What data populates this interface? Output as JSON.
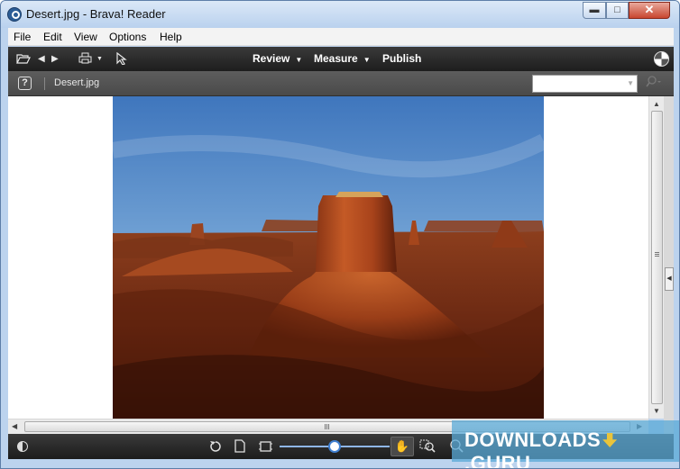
{
  "window": {
    "title": "Desert.jpg - Brava! Reader",
    "min_label": "▬",
    "max_label": "□",
    "close_label": "✕"
  },
  "menu": {
    "items": [
      "File",
      "Edit",
      "View",
      "Options",
      "Help"
    ]
  },
  "toolbar": {
    "review_label": "Review",
    "measure_label": "Measure",
    "publish_label": "Publish"
  },
  "docbar": {
    "help_label": "?",
    "tab_label": "Desert.jpg",
    "search_placeholder": ""
  },
  "watermark": {
    "text_before": "DOWNLOADS",
    "text_after": ".GURU"
  },
  "icons": {
    "open": "folder-open-icon",
    "back": "arrow-left-icon",
    "forward": "arrow-right-icon",
    "print": "print-icon",
    "select": "cursor-icon",
    "rotate": "rotate-icon",
    "page": "page-icon",
    "fit": "fit-page-icon",
    "pan": "hand-icon",
    "zoom_box": "zoom-region-icon",
    "zoom_out": "zoom-icon"
  },
  "colors": {
    "toolbar_bg": "#2a2a2a",
    "accent": "#3f7fd1",
    "titlebar": "#c9dcf2"
  },
  "zoom_slider": {
    "level": 0.5
  }
}
